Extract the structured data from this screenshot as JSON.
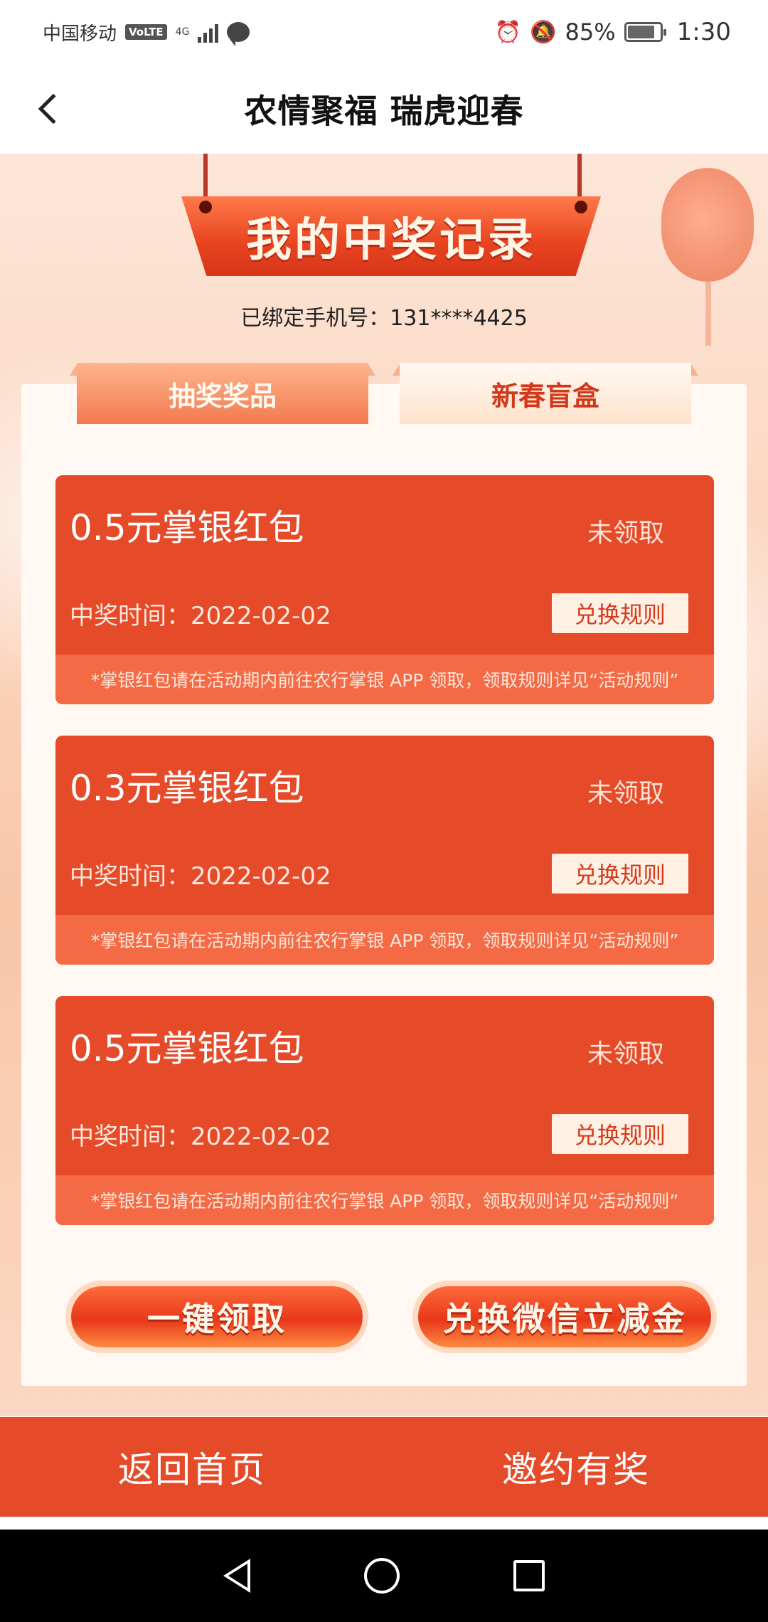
{
  "status_bar": {
    "carrier": "中国移动",
    "volte": "VoLTE",
    "network": "4G",
    "battery_percent": "85%",
    "battery_level": 0.85,
    "time": "1:30"
  },
  "nav": {
    "title": "农情聚福 瑞虎迎春"
  },
  "header": {
    "banner_title": "我的中奖记录",
    "phone_label": "已绑定手机号：",
    "phone_number": "131****4425"
  },
  "tabs": [
    {
      "label": "抽奖奖品",
      "active": true
    },
    {
      "label": "新春盲盒",
      "active": false
    }
  ],
  "cards": [
    {
      "name": "0.5元掌银红包",
      "status": "未领取",
      "time_label": "中奖时间：",
      "time": "2022-02-02",
      "rule_button": "兑换规则",
      "note": "*掌银红包请在活动期内前往农行掌银 APP 领取，领取规则详见“活动规则”"
    },
    {
      "name": "0.3元掌银红包",
      "status": "未领取",
      "time_label": "中奖时间：",
      "time": "2022-02-02",
      "rule_button": "兑换规则",
      "note": "*掌银红包请在活动期内前往农行掌银 APP 领取，领取规则详见“活动规则”"
    },
    {
      "name": "0.5元掌银红包",
      "status": "未领取",
      "time_label": "中奖时间：",
      "time": "2022-02-02",
      "rule_button": "兑换规则",
      "note": "*掌银红包请在活动期内前往农行掌银 APP 领取，领取规则详见“活动规则”"
    }
  ],
  "actions": {
    "claim_all": "一键领取",
    "exchange_wechat": "兑换微信立减金"
  },
  "bottom_nav": {
    "home": "返回首页",
    "invite": "邀约有奖"
  },
  "colors": {
    "brand_red": "#e54a29",
    "note_red": "#f36a45",
    "background_peach": "#fbd4bd"
  }
}
